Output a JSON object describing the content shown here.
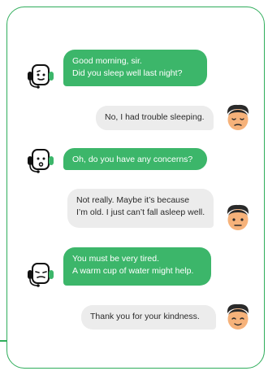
{
  "conversation": {
    "messages": [
      {
        "sender": "bot",
        "lines": [
          "Good morning, sir.",
          "Did you sleep well last night?"
        ]
      },
      {
        "sender": "user",
        "lines": [
          "No, I had trouble sleeping."
        ]
      },
      {
        "sender": "bot",
        "lines": [
          "Oh, do you have any concerns?"
        ]
      },
      {
        "sender": "user",
        "lines": [
          "Not really. Maybe it’s because",
          "I’m old. I just can’t fall asleep well."
        ]
      },
      {
        "sender": "bot",
        "lines": [
          "You must be very tired.",
          "A warm cup of water might help."
        ]
      },
      {
        "sender": "user",
        "lines": [
          "Thank you for your kindness."
        ]
      }
    ]
  },
  "colors": {
    "accent": "#2fad5b",
    "bot_bubble": "#3cb66a",
    "user_bubble": "#ececec",
    "skin": "#f6b27a",
    "hair": "#2a2a2a"
  },
  "icons": {
    "bot": "robot-headset-icon",
    "user": "elderly-man-avatar-icon"
  }
}
